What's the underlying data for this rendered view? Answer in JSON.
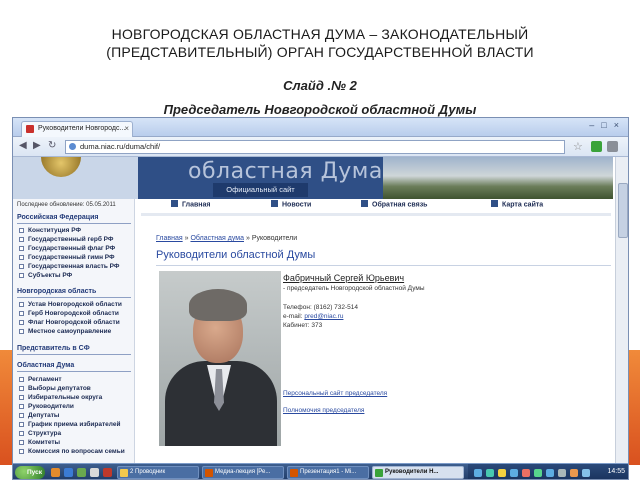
{
  "slide": {
    "title_line1": "НОВГОРОДСКАЯ ОБЛАСТНАЯ ДУМА – ЗАКОНОДАТЕЛЬНЫЙ",
    "title_line2": "(ПРЕДСТАВИТЕЛЬНЫЙ) ОРГАН ГОСУДАРСТВЕННОЙ ВЛАСТИ",
    "slide_number": "Слайд .№ 2",
    "subtitle": "Председатель Новгородской областной Думы"
  },
  "browser": {
    "tab_label": "Руководители Новгородс...",
    "url": "duma.niac.ru/duma/chif/"
  },
  "site": {
    "banner_title": "областная Дума",
    "banner_tag": "Официальный сайт",
    "updated": "Последнее обновление: 05.05.2011",
    "menu": [
      "Главная",
      "Новости",
      "Обратная связь",
      "Карта сайта"
    ],
    "sections": [
      {
        "title": "Российская Федерация",
        "items": [
          "Конституция РФ",
          "Государственный герб РФ",
          "Государственный флаг РФ",
          "Государственный гимн РФ",
          "Государственная власть РФ",
          "Субъекты РФ"
        ]
      },
      {
        "title": "Новгородская область",
        "items": [
          "Устав Новгородской области",
          "Герб Новгородской области",
          "Флаг Новгородской области",
          "Местное самоуправление"
        ]
      },
      {
        "title": "Представитель в СФ",
        "items": []
      },
      {
        "title": "Областная Дума",
        "items": [
          "Регламент",
          "Выборы депутатов",
          "Избирательные округа",
          "Руководители",
          "Депутаты",
          "График приема избирателей",
          "Структура",
          "Комитеты",
          "Комиссия по вопросам семьи"
        ]
      }
    ],
    "breadcrumb": {
      "home": "Главная",
      "sep": "»",
      "parent": "Областная дума",
      "current": "Руководители"
    },
    "content_title": "Руководители областной Думы",
    "person": {
      "name": "Фабричный Сергей Юрьевич",
      "role": "- председатель Новгородской областной Думы",
      "phone": "Телефон: (8162) 732-514",
      "email_label": "e-mail:",
      "email": "pred@niac.ru",
      "office": "Кабинет: 373",
      "link1": "Персональный сайт председателя",
      "link2": "Полномочия председателя"
    }
  },
  "taskbar": {
    "start": "Пуск",
    "tasks": [
      "2 Проводник",
      "Медиа-лекция [Ре...",
      "Презентация1 - Mi...",
      "Руководители Н..."
    ],
    "clock": "14:55"
  },
  "colors": {
    "accent_orange": "#e8672a",
    "banner_blue": "#2f4f86",
    "link_blue": "#2a4aa0",
    "taskbar_blue": "#1f3a66"
  }
}
